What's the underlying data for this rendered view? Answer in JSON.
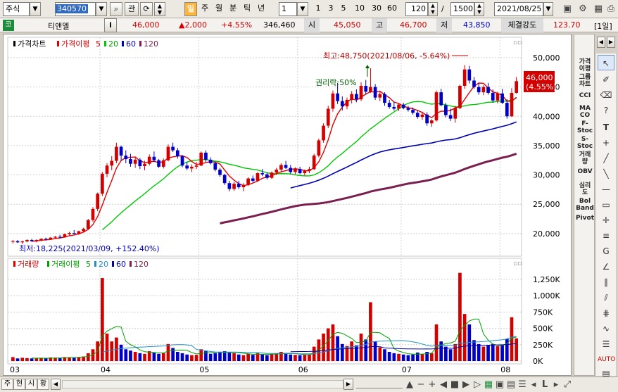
{
  "toolbar": {
    "market_select": "주식",
    "stock_code": "340570",
    "btn_gwan": "관",
    "period_buttons": [
      "일",
      "주",
      "월",
      "분",
      "틱",
      "년"
    ],
    "minute_value": "1",
    "interval_buttons": [
      "1",
      "3",
      "5",
      "10",
      "30",
      "60"
    ],
    "display_count": "120",
    "separator": "/",
    "total_count": "1500",
    "date": "2021/08/25"
  },
  "info": {
    "icon_label": "코",
    "info_button": "i",
    "name": "티앤엘",
    "price": "46,000",
    "change": "▲2,000",
    "change_pct": "+4.55%",
    "volume": "346,460",
    "open_label": "시",
    "open": "45,050",
    "high_label": "고",
    "high": "46,700",
    "low_label": "저",
    "low": "43,850",
    "strength_label": "체결강도",
    "strength": "123.70",
    "period_badge": "[1일]"
  },
  "price_legend": {
    "main": "가격차트",
    "ma_label": "가격이평",
    "ma5": "5",
    "ma20": "20",
    "ma60": "60",
    "ma120": "120"
  },
  "volume_legend": {
    "main": "거래량",
    "ma_label": "거래이평",
    "ma5": "5",
    "ma20": "20",
    "ma60": "60",
    "ma120": "120"
  },
  "annotations": {
    "high": "최고:48,750(2021/08/06, -5.64%)",
    "low": "최저:18,225(2021/03/09, +152.40%)",
    "rights": "권리락:50%",
    "current_price": "46,000",
    "current_pct": "(4.55%)"
  },
  "price_axis": [
    "50,000",
    "45,000",
    "40,000",
    "35,000",
    "30,000",
    "25,000",
    "20,000"
  ],
  "volume_axis": [
    "1,250K",
    "1,000K",
    "750K",
    "500K",
    "250K",
    "0K"
  ],
  "x_axis": [
    "03",
    "04",
    "05",
    "06",
    "07",
    "08"
  ],
  "side_indicators": [
    "가격\n이평",
    "그룹\n차트",
    "CCI",
    "MA\nCO",
    "F-\nStoc",
    "S-\nStoc",
    "거래\n량",
    "OBV",
    "심리\n도",
    "Bol\nBand",
    "Pivot"
  ],
  "bottom_tabs": [
    "주",
    "현",
    "시",
    "황"
  ],
  "colors": {
    "up": "#d40000",
    "down": "#0000c8",
    "ma5": "#e00000",
    "ma20": "#00c800",
    "ma60": "#0000b0",
    "ma120": "#7a1f4f"
  },
  "chart_data": {
    "type": "candlestick",
    "title": "가격차트",
    "price_ylim": [
      16500,
      53000
    ],
    "volume_ylim": [
      0,
      1400
    ],
    "volume_unit": "K",
    "x_months": [
      "03",
      "04",
      "05",
      "06",
      "07",
      "08"
    ],
    "candles": [
      [
        18600,
        18900,
        18300,
        18700,
        60
      ],
      [
        18700,
        18900,
        18400,
        18500,
        40
      ],
      [
        18500,
        18800,
        18225,
        18650,
        50
      ],
      [
        18650,
        19000,
        18500,
        18900,
        45
      ],
      [
        18900,
        19100,
        18600,
        18700,
        40
      ],
      [
        18700,
        19000,
        18500,
        18900,
        42
      ],
      [
        18900,
        19200,
        18700,
        19100,
        48
      ],
      [
        19100,
        19300,
        18800,
        19000,
        40
      ],
      [
        19000,
        19400,
        18900,
        19300,
        55
      ],
      [
        19300,
        19600,
        19100,
        19450,
        50
      ],
      [
        19450,
        19800,
        19200,
        19350,
        45
      ],
      [
        19350,
        20000,
        19300,
        19900,
        60
      ],
      [
        19900,
        20300,
        19700,
        20100,
        58
      ],
      [
        20100,
        20600,
        19900,
        19950,
        50
      ],
      [
        19950,
        20500,
        19800,
        20400,
        62
      ],
      [
        20400,
        21000,
        20200,
        20800,
        70
      ],
      [
        20800,
        22500,
        20600,
        22300,
        120
      ],
      [
        22300,
        24500,
        22000,
        24200,
        180
      ],
      [
        24200,
        27000,
        23800,
        26800,
        300
      ],
      [
        26800,
        30500,
        26400,
        30200,
        1270
      ],
      [
        30200,
        32000,
        29600,
        31600,
        420
      ],
      [
        31600,
        33200,
        30800,
        32400,
        300
      ],
      [
        32400,
        35500,
        32000,
        34800,
        360
      ],
      [
        34800,
        35000,
        32400,
        33300,
        250
      ],
      [
        33300,
        34200,
        32000,
        32700,
        180
      ],
      [
        32700,
        33600,
        31400,
        31900,
        160
      ],
      [
        31900,
        33000,
        31200,
        32600,
        140
      ],
      [
        32600,
        32900,
        31000,
        31500,
        120
      ],
      [
        31500,
        32400,
        30800,
        31900,
        110
      ],
      [
        31900,
        33500,
        31600,
        33100,
        150
      ],
      [
        33100,
        34000,
        32200,
        32500,
        130
      ],
      [
        32500,
        32700,
        31200,
        31400,
        110
      ],
      [
        31400,
        32800,
        31100,
        32500,
        120
      ],
      [
        32500,
        35200,
        32300,
        34800,
        260
      ],
      [
        34800,
        35500,
        33900,
        34200,
        200
      ],
      [
        34200,
        34600,
        32800,
        33200,
        140
      ],
      [
        33200,
        33400,
        31300,
        31600,
        120
      ],
      [
        31600,
        32200,
        30800,
        31100,
        100
      ],
      [
        31100,
        31800,
        30500,
        31400,
        90
      ],
      [
        31400,
        32200,
        31000,
        31600,
        95
      ],
      [
        31600,
        34000,
        31500,
        33800,
        180
      ],
      [
        33800,
        34200,
        32200,
        32600,
        150
      ],
      [
        32600,
        33000,
        31800,
        32000,
        110
      ],
      [
        32000,
        32300,
        30600,
        30900,
        120
      ],
      [
        30900,
        31200,
        29700,
        30000,
        130
      ],
      [
        30000,
        30200,
        28300,
        28600,
        150
      ],
      [
        28600,
        29000,
        27200,
        27600,
        140
      ],
      [
        27600,
        28800,
        27300,
        28500,
        120
      ],
      [
        28500,
        29000,
        27600,
        27900,
        100
      ],
      [
        27900,
        28600,
        27200,
        28300,
        90
      ],
      [
        28300,
        29600,
        28100,
        29400,
        110
      ],
      [
        29400,
        29900,
        28700,
        29000,
        95
      ],
      [
        29000,
        30500,
        28800,
        30300,
        120
      ],
      [
        30300,
        31000,
        29800,
        30100,
        100
      ],
      [
        30100,
        30400,
        29200,
        29500,
        90
      ],
      [
        29500,
        30600,
        29300,
        30400,
        110
      ],
      [
        30400,
        31200,
        30000,
        30900,
        120
      ],
      [
        30900,
        32000,
        30600,
        31700,
        140
      ],
      [
        31700,
        32400,
        31000,
        31200,
        110
      ],
      [
        31200,
        31700,
        30200,
        30500,
        100
      ],
      [
        30500,
        31300,
        30100,
        31000,
        95
      ],
      [
        31000,
        31400,
        30100,
        30300,
        90
      ],
      [
        30300,
        30900,
        29900,
        30700,
        95
      ],
      [
        30700,
        31400,
        30300,
        31000,
        100
      ],
      [
        31000,
        33600,
        30800,
        33300,
        220
      ],
      [
        33300,
        36200,
        33000,
        35900,
        330
      ],
      [
        35900,
        38800,
        35500,
        38400,
        420
      ],
      [
        38400,
        41800,
        38000,
        41300,
        500
      ],
      [
        41300,
        44400,
        40800,
        43900,
        560
      ],
      [
        43900,
        45700,
        42100,
        42600,
        380
      ],
      [
        42600,
        43400,
        41000,
        41700,
        260
      ],
      [
        41700,
        43200,
        41200,
        42800,
        230
      ],
      [
        42800,
        44300,
        42200,
        43800,
        300
      ],
      [
        43800,
        44600,
        42400,
        42900,
        240
      ],
      [
        42900,
        45800,
        42600,
        45200,
        420
      ],
      [
        45200,
        46200,
        43700,
        44200,
        330
      ],
      [
        44200,
        48200,
        44000,
        45000,
        900
      ],
      [
        45000,
        45500,
        42800,
        43200,
        300
      ],
      [
        43200,
        44300,
        42600,
        43800,
        210
      ],
      [
        43800,
        44100,
        41800,
        42300,
        180
      ],
      [
        42300,
        42800,
        41300,
        41600,
        140
      ],
      [
        41600,
        42500,
        41000,
        41300,
        120
      ],
      [
        41300,
        42200,
        40900,
        42000,
        110
      ],
      [
        42000,
        42300,
        41200,
        41400,
        100
      ],
      [
        41400,
        41800,
        40800,
        41100,
        90
      ],
      [
        41100,
        41500,
        40300,
        40600,
        100
      ],
      [
        40600,
        41000,
        39600,
        39900,
        130
      ],
      [
        39900,
        40600,
        39400,
        40300,
        110
      ],
      [
        40300,
        40700,
        38400,
        38800,
        140
      ],
      [
        38800,
        39500,
        38200,
        39300,
        120
      ],
      [
        39300,
        44400,
        39100,
        44100,
        560
      ],
      [
        44100,
        44700,
        41700,
        41900,
        300
      ],
      [
        41900,
        42300,
        39800,
        40200,
        220
      ],
      [
        40200,
        41300,
        39200,
        39600,
        180
      ],
      [
        39600,
        41800,
        38900,
        41400,
        260
      ],
      [
        41400,
        45400,
        41200,
        45200,
        1350
      ],
      [
        45200,
        48750,
        44700,
        48000,
        720
      ],
      [
        48000,
        48600,
        45600,
        46100,
        560
      ],
      [
        46100,
        46700,
        44700,
        45000,
        320
      ],
      [
        45000,
        45600,
        43700,
        44100,
        260
      ],
      [
        44100,
        45300,
        43600,
        45000,
        220
      ],
      [
        45000,
        45700,
        43700,
        44000,
        240
      ],
      [
        44000,
        44600,
        42300,
        42700,
        260
      ],
      [
        42700,
        44200,
        42200,
        43900,
        230
      ],
      [
        43900,
        44700,
        42100,
        42300,
        250
      ],
      [
        42300,
        42900,
        39600,
        40000,
        340
      ],
      [
        40000,
        44800,
        39900,
        44000,
        670
      ],
      [
        44000,
        46700,
        43850,
        46000,
        346
      ]
    ]
  }
}
